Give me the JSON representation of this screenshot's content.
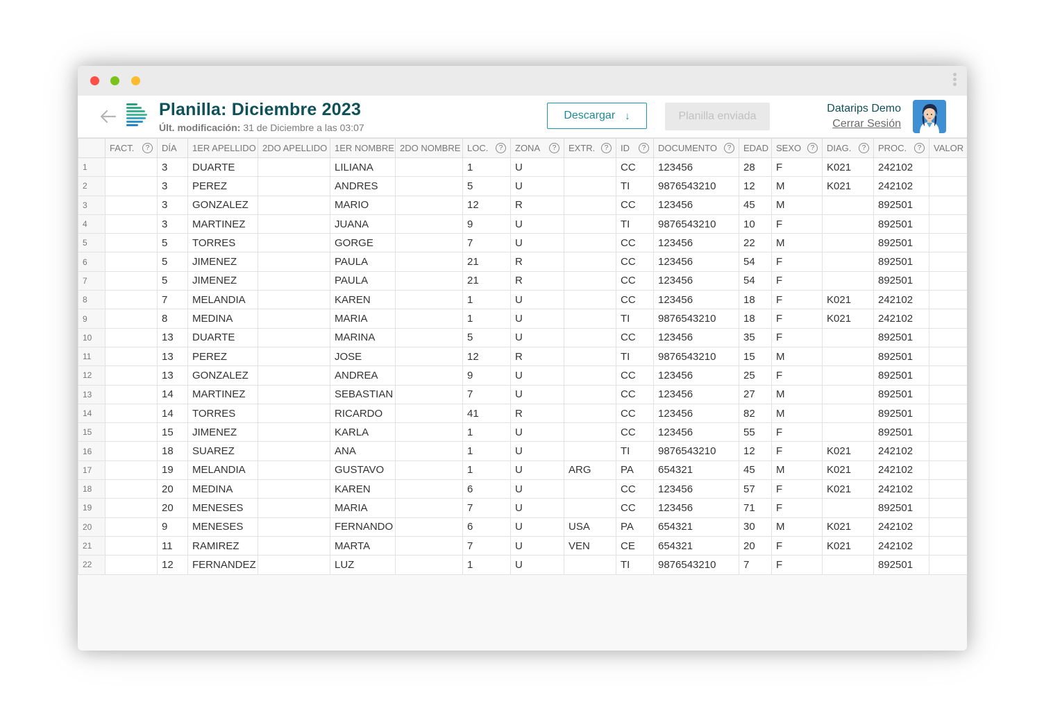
{
  "header": {
    "title": "Planilla: Diciembre 2023",
    "last_modified_label": "Últ. modificación:",
    "last_modified_value": "31 de Diciembre a las 03:07",
    "download_label": "Descargar",
    "sent_label": "Planilla enviada",
    "user_name": "Datarips Demo",
    "logout_label": "Cerrar Sesión"
  },
  "colors": {
    "accent": "#0e5158",
    "button_border": "#1b9aa5"
  },
  "columns": [
    {
      "label": "",
      "help": false
    },
    {
      "label": "FACT.",
      "help": true
    },
    {
      "label": "DÍA",
      "help": false
    },
    {
      "label": "1ER APELLIDO",
      "help": false
    },
    {
      "label": "2DO APELLIDO",
      "help": false
    },
    {
      "label": "1ER NOMBRE",
      "help": false
    },
    {
      "label": "2DO NOMBRE",
      "help": false
    },
    {
      "label": "LOC.",
      "help": true
    },
    {
      "label": "ZONA",
      "help": true
    },
    {
      "label": "EXTR.",
      "help": true
    },
    {
      "label": "ID",
      "help": true
    },
    {
      "label": "DOCUMENTO",
      "help": true
    },
    {
      "label": "EDAD",
      "help": false
    },
    {
      "label": "SEXO",
      "help": true
    },
    {
      "label": "DIAG.",
      "help": true
    },
    {
      "label": "PROC.",
      "help": true
    },
    {
      "label": "VALOR",
      "help": false
    }
  ],
  "rows": [
    [
      "1",
      "",
      "3",
      "DUARTE",
      "",
      "LILIANA",
      "",
      "1",
      "U",
      "",
      "CC",
      "123456",
      "28",
      "F",
      "K021",
      "242102",
      ""
    ],
    [
      "2",
      "",
      "3",
      "PEREZ",
      "",
      "ANDRES",
      "",
      "5",
      "U",
      "",
      "TI",
      "9876543210",
      "12",
      "M",
      "K021",
      "242102",
      ""
    ],
    [
      "3",
      "",
      "3",
      "GONZALEZ",
      "",
      "MARIO",
      "",
      "12",
      "R",
      "",
      "CC",
      "123456",
      "45",
      "M",
      "",
      "892501",
      ""
    ],
    [
      "4",
      "",
      "3",
      "MARTINEZ",
      "",
      "JUANA",
      "",
      "9",
      "U",
      "",
      "TI",
      "9876543210",
      "10",
      "F",
      "",
      "892501",
      ""
    ],
    [
      "5",
      "",
      "5",
      "TORRES",
      "",
      "GORGE",
      "",
      "7",
      "U",
      "",
      "CC",
      "123456",
      "22",
      "M",
      "",
      "892501",
      ""
    ],
    [
      "6",
      "",
      "5",
      "JIMENEZ",
      "",
      "PAULA",
      "",
      "21",
      "R",
      "",
      "CC",
      "123456",
      "54",
      "F",
      "",
      "892501",
      ""
    ],
    [
      "7",
      "",
      "5",
      "JIMENEZ",
      "",
      "PAULA",
      "",
      "21",
      "R",
      "",
      "CC",
      "123456",
      "54",
      "F",
      "",
      "892501",
      ""
    ],
    [
      "8",
      "",
      "7",
      "MELANDIA",
      "",
      "KAREN",
      "",
      "1",
      "U",
      "",
      "CC",
      "123456",
      "18",
      "F",
      "K021",
      "242102",
      ""
    ],
    [
      "9",
      "",
      "8",
      "MEDINA",
      "",
      "MARIA",
      "",
      "1",
      "U",
      "",
      "TI",
      "9876543210",
      "18",
      "F",
      "K021",
      "242102",
      ""
    ],
    [
      "10",
      "",
      "13",
      "DUARTE",
      "",
      "MARINA",
      "",
      "5",
      "U",
      "",
      "CC",
      "123456",
      "35",
      "F",
      "",
      "892501",
      ""
    ],
    [
      "11",
      "",
      "13",
      "PEREZ",
      "",
      "JOSE",
      "",
      "12",
      "R",
      "",
      "TI",
      "9876543210",
      "15",
      "M",
      "",
      "892501",
      ""
    ],
    [
      "12",
      "",
      "13",
      "GONZALEZ",
      "",
      "ANDREA",
      "",
      "9",
      "U",
      "",
      "CC",
      "123456",
      "25",
      "F",
      "",
      "892501",
      ""
    ],
    [
      "13",
      "",
      "14",
      "MARTINEZ",
      "",
      "SEBASTIAN",
      "",
      "7",
      "U",
      "",
      "CC",
      "123456",
      "27",
      "M",
      "",
      "892501",
      ""
    ],
    [
      "14",
      "",
      "14",
      "TORRES",
      "",
      "RICARDO",
      "",
      "41",
      "R",
      "",
      "CC",
      "123456",
      "82",
      "M",
      "",
      "892501",
      ""
    ],
    [
      "15",
      "",
      "15",
      "JIMENEZ",
      "",
      "KARLA",
      "",
      "1",
      "U",
      "",
      "CC",
      "123456",
      "55",
      "F",
      "",
      "892501",
      ""
    ],
    [
      "16",
      "",
      "18",
      "SUAREZ",
      "",
      "ANA",
      "",
      "1",
      "U",
      "",
      "TI",
      "9876543210",
      "12",
      "F",
      "K021",
      "242102",
      ""
    ],
    [
      "17",
      "",
      "19",
      "MELANDIA",
      "",
      "GUSTAVO",
      "",
      "1",
      "U",
      "ARG",
      "PA",
      "654321",
      "45",
      "M",
      "K021",
      "242102",
      ""
    ],
    [
      "18",
      "",
      "20",
      "MEDINA",
      "",
      "KAREN",
      "",
      "6",
      "U",
      "",
      "CC",
      "123456",
      "57",
      "F",
      "K021",
      "242102",
      ""
    ],
    [
      "19",
      "",
      "20",
      "MENESES",
      "",
      "MARIA",
      "",
      "7",
      "U",
      "",
      "CC",
      "123456",
      "71",
      "F",
      "",
      "892501",
      ""
    ],
    [
      "20",
      "",
      "9",
      "MENESES",
      "",
      "FERNANDO",
      "",
      "6",
      "U",
      "USA",
      "PA",
      "654321",
      "30",
      "M",
      "K021",
      "242102",
      ""
    ],
    [
      "21",
      "",
      "11",
      "RAMIREZ",
      "",
      "MARTA",
      "",
      "7",
      "U",
      "VEN",
      "CE",
      "654321",
      "20",
      "F",
      "K021",
      "242102",
      ""
    ],
    [
      "22",
      "",
      "12",
      "FERNANDEZ",
      "",
      "LUZ",
      "",
      "1",
      "U",
      "",
      "TI",
      "9876543210",
      "7",
      "F",
      "",
      "892501",
      ""
    ]
  ]
}
